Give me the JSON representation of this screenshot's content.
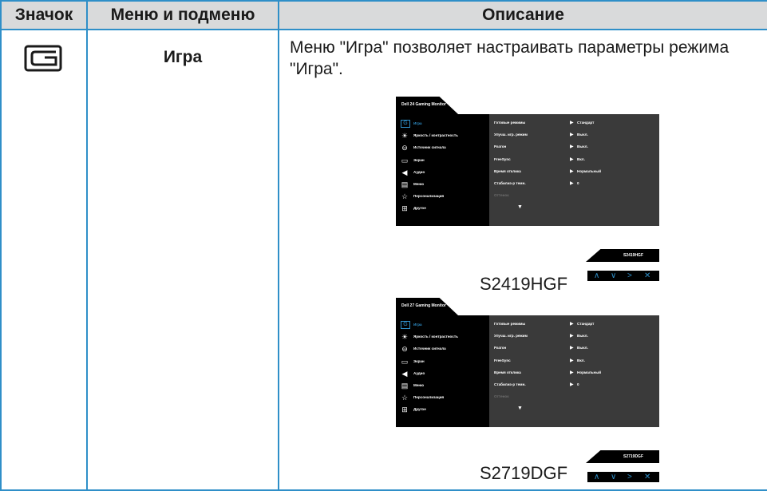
{
  "table": {
    "headers": {
      "icon": "Значок",
      "menu": "Меню и подменю",
      "desc": "Описание"
    },
    "row": {
      "icon_name": "game-icon",
      "menu": "Игра",
      "description": "Меню \"Игра\" позволяет настраивать параметры режима \"Игра\"."
    }
  },
  "osd_menu_items": [
    {
      "icon": "game-icon",
      "glyph": "G",
      "label": "Игра"
    },
    {
      "icon": "brightness-icon",
      "glyph": "☀",
      "label": "Яркость / контрастность"
    },
    {
      "icon": "input-source-icon",
      "glyph": "⊖",
      "label": "Источник сигнала"
    },
    {
      "icon": "display-icon",
      "glyph": "▭",
      "label": "Экран"
    },
    {
      "icon": "audio-icon",
      "glyph": "◀",
      "label": "Аудио"
    },
    {
      "icon": "menu-icon",
      "glyph": "▤",
      "label": "Меню"
    },
    {
      "icon": "star-icon",
      "glyph": "☆",
      "label": "Персонализация"
    },
    {
      "icon": "other-icon",
      "glyph": "⊞",
      "label": "Другое"
    }
  ],
  "osd_settings": [
    {
      "label": "Готовые режимы",
      "value": "Стандарт"
    },
    {
      "label": "Улучш. игр. режим",
      "value": "Выкл."
    },
    {
      "label": "Разгон",
      "value": "Выкл."
    },
    {
      "label": "FreeSync",
      "value": "Вкл."
    },
    {
      "label": "Время отклика",
      "value": "Нормальный"
    },
    {
      "label": "Стабилиз-р темн.",
      "value": "0"
    },
    {
      "label": "Оттенок",
      "value": ""
    }
  ],
  "osd_glyphs": {
    "arrow": "▶",
    "more": "▼",
    "nav": [
      "∧",
      "∨",
      ">",
      "✕"
    ]
  },
  "screens": [
    {
      "title": "Dell 24 Gaming Monitor",
      "model": "S2419HGF",
      "caption": "S2419HGF"
    },
    {
      "title": "Dell 27 Gaming Monitor",
      "model": "S2719DGF",
      "caption": "S2719DGF"
    }
  ],
  "colors": {
    "border": "#2f8fc8",
    "header_bg": "#d9dadb",
    "accent": "#2f8fc8"
  }
}
